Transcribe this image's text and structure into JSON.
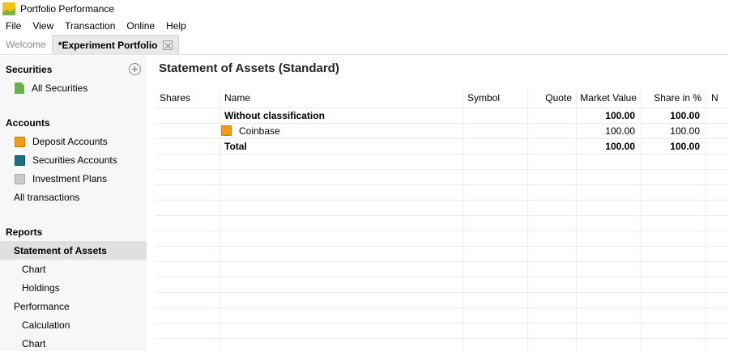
{
  "window": {
    "title": "Portfolio Performance"
  },
  "menu": [
    "File",
    "View",
    "Transaction",
    "Online",
    "Help"
  ],
  "tabs": [
    {
      "label": "Welcome",
      "active": false
    },
    {
      "label": "*Experiment Portfolio",
      "active": true
    }
  ],
  "sidebar": {
    "securities": {
      "header": "Securities",
      "items": [
        "All Securities"
      ]
    },
    "accounts": {
      "header": "Accounts",
      "items": [
        "Deposit Accounts",
        "Securities Accounts",
        "Investment Plans",
        "All transactions"
      ]
    },
    "reports": {
      "header": "Reports",
      "items": [
        "Statement of Assets",
        "Chart",
        "Holdings",
        "Performance",
        "Calculation",
        "Chart"
      ]
    }
  },
  "main": {
    "title": "Statement of Assets (Standard)",
    "columns": [
      "Shares",
      "Name",
      "Symbol",
      "Quote",
      "Market Value",
      "Share in %",
      "N"
    ],
    "rows": [
      {
        "name": "Without classification",
        "market_value": "100.00",
        "share": "100.00"
      },
      {
        "name": "Coinbase",
        "market_value": "100.00",
        "share": "100.00"
      },
      {
        "name": "Total",
        "market_value": "100.00",
        "share": "100.00"
      }
    ]
  },
  "colors": {
    "accent_orange": "#f39c12",
    "accent_teal": "#1c6f7e",
    "accent_green": "#6ab04c",
    "selection": "#e0e0e0"
  }
}
